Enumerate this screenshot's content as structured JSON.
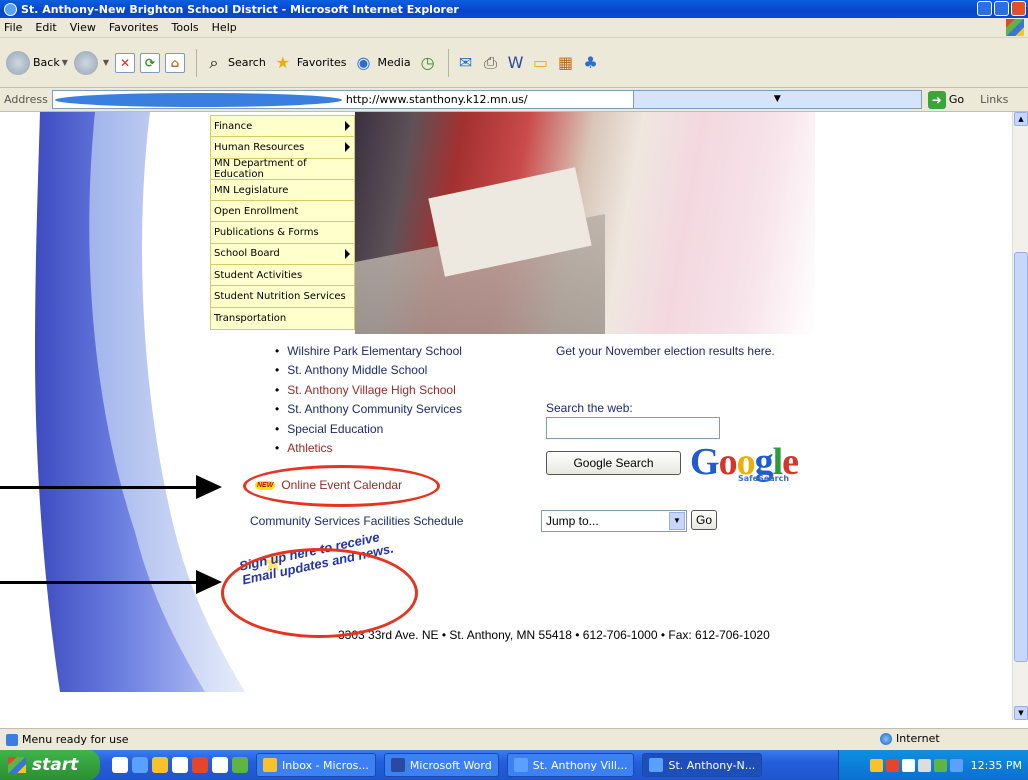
{
  "window": {
    "title": "St. Anthony-New Brighton School District - Microsoft Internet Explorer"
  },
  "menubar": [
    "File",
    "Edit",
    "View",
    "Favorites",
    "Tools",
    "Help"
  ],
  "toolbar": {
    "back": "Back",
    "search": "Search",
    "favorites": "Favorites",
    "media": "Media"
  },
  "addressbar": {
    "label": "Address",
    "url": "http://www.stanthony.k12.mn.us/",
    "go": "Go",
    "links": "Links"
  },
  "sidemenu": [
    {
      "label": "Finance",
      "submenu": true
    },
    {
      "label": "Human Resources",
      "submenu": true
    },
    {
      "label": "MN Department of Education",
      "submenu": false
    },
    {
      "label": "MN Legislature",
      "submenu": false
    },
    {
      "label": "Open Enrollment",
      "submenu": false
    },
    {
      "label": "Publications & Forms",
      "submenu": false
    },
    {
      "label": "School Board",
      "submenu": true
    },
    {
      "label": "Student Activities",
      "submenu": false
    },
    {
      "label": "Student Nutrition Services",
      "submenu": false
    },
    {
      "label": "Transportation",
      "submenu": false
    }
  ],
  "schools": [
    {
      "label": "Wilshire Park Elementary School",
      "color": "#1e2a6e"
    },
    {
      "label": "St. Anthony Middle School",
      "color": "#1e2a6e"
    },
    {
      "label": "St. Anthony Village High School",
      "color": "#9a2a2a"
    },
    {
      "label": "St. Anthony Community Services",
      "color": "#1e2a6e"
    },
    {
      "label": "Special Education",
      "color": "#1e2a6e"
    },
    {
      "label": "Athletics",
      "color": "#9a2a2a"
    }
  ],
  "calendar": {
    "badge": "NEW",
    "label": "Online Event Calendar"
  },
  "facilities": "Community Services Facilities Schedule",
  "election": "Get your November election results here.",
  "search": {
    "label": "Search the web:",
    "value": "",
    "button": "Google Search",
    "logo": "Google",
    "safesearch": "SafeSearch"
  },
  "jump": {
    "selected": "Jump to...",
    "go": "Go"
  },
  "signup": {
    "badge": "New",
    "line1": "Sign up here to receive",
    "line2": "Email updates and news."
  },
  "address_line": "3303 33rd Ave. NE • St. Anthony, MN 55418 • 612-706-1000 • Fax: 612-706-1020",
  "statusbar": {
    "text": "Menu ready for use",
    "zone": "Internet"
  },
  "taskbar": {
    "start": "start",
    "tasks": [
      {
        "label": "Inbox - Micros...",
        "active": false
      },
      {
        "label": "Microsoft Word",
        "active": false
      },
      {
        "label": "St. Anthony Vill...",
        "active": false
      },
      {
        "label": "St. Anthony-N...",
        "active": true
      }
    ],
    "clock": "12:35 PM"
  },
  "colors": {
    "link_blue": "#1e2a6e",
    "link_red": "#9a2a2a",
    "menu_bg": "#ffffcc",
    "annotation_red": "#e8341f"
  }
}
